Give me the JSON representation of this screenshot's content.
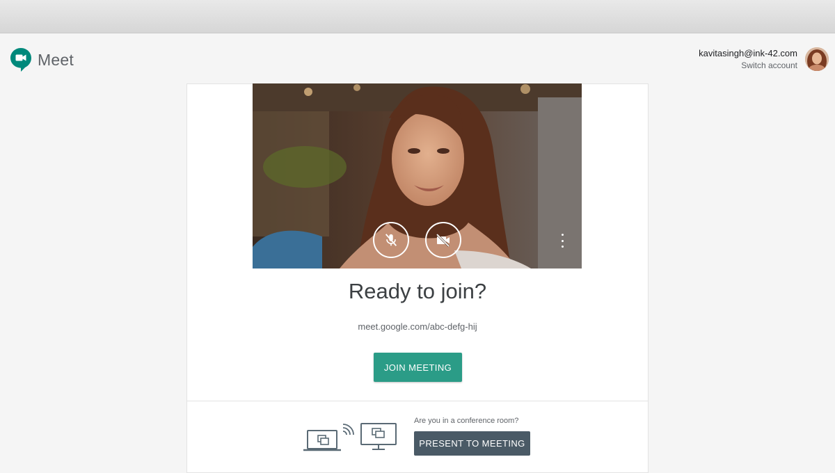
{
  "app": {
    "name": "Meet"
  },
  "account": {
    "email": "kavitasingh@ink-42.com",
    "switch_label": "Switch account"
  },
  "preview": {
    "mic_state": "muted",
    "camera_state": "off"
  },
  "main": {
    "title": "Ready to join?",
    "meeting_url": "meet.google.com/abc-defg-hij",
    "join_label": "JOIN MEETING"
  },
  "conference": {
    "question": "Are you in a conference room?",
    "present_label": "PRESENT TO MEETING"
  },
  "colors": {
    "join_button": "#2b9c87",
    "present_button": "#4a5a66",
    "logo_teal": "#00897b"
  },
  "icons": {
    "logo": "meet-logo-icon",
    "mic": "mic-off-icon",
    "camera": "camera-off-icon",
    "more": "more-vert-icon",
    "laptop": "laptop-cast-icon",
    "signal": "cast-signal-icon",
    "monitor": "monitor-icon"
  }
}
